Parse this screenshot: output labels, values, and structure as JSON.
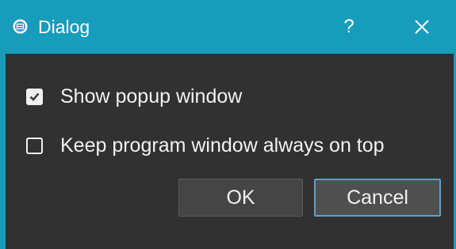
{
  "window": {
    "title": "Dialog",
    "help_label": "?",
    "icons": {
      "app": "app-icon",
      "close": "close-icon"
    }
  },
  "options": [
    {
      "label": "Show popup window",
      "checked": true
    },
    {
      "label": "Keep program window always on top",
      "checked": false
    }
  ],
  "buttons": {
    "ok_label": "OK",
    "cancel_label": "Cancel"
  },
  "colors": {
    "titlebar": "#179cbc",
    "background": "#313131",
    "text": "#f2f2f2",
    "focus_border": "#5aa3cc"
  }
}
